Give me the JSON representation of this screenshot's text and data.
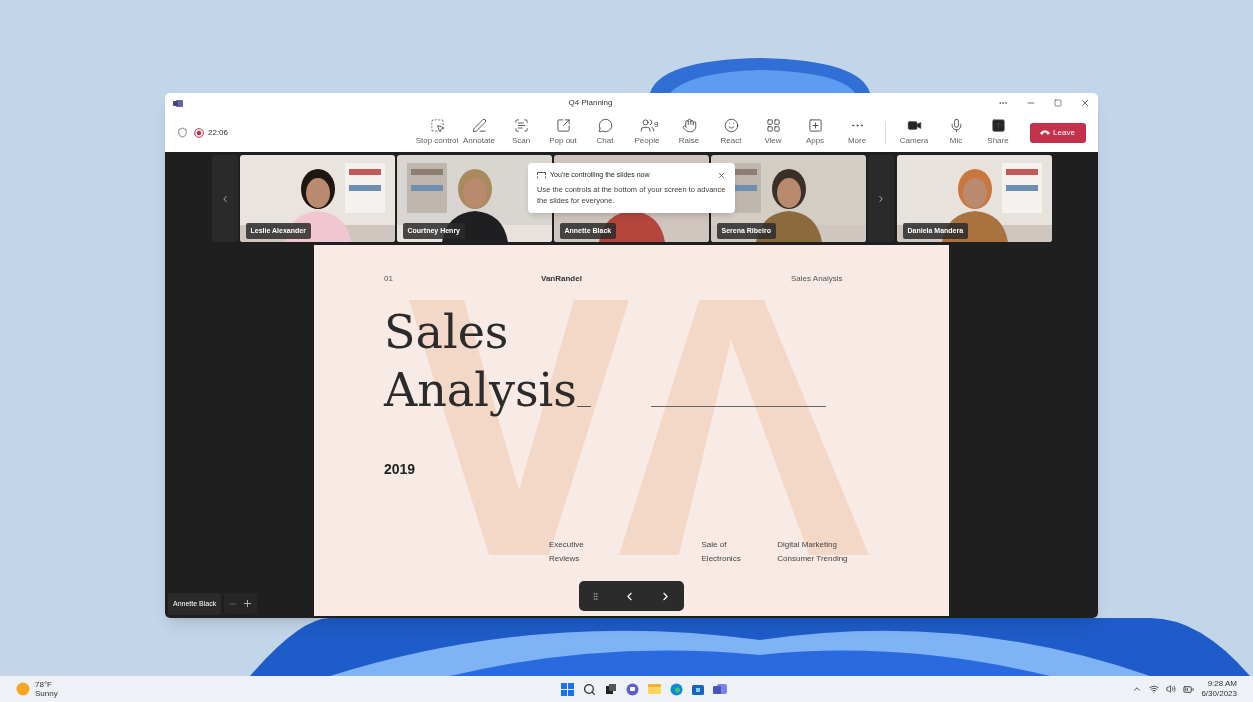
{
  "window": {
    "title": "Q4 Planning"
  },
  "meeting": {
    "timer": "22:06",
    "recording": true
  },
  "toolbar": [
    {
      "kind": "stopcontrol",
      "label": "Stop control"
    },
    {
      "kind": "annotate",
      "label": "Annotate"
    },
    {
      "kind": "scan",
      "label": "Scan"
    },
    {
      "kind": "popout",
      "label": "Pop out"
    },
    {
      "kind": "chat",
      "label": "Chat"
    },
    {
      "kind": "people",
      "label": "People",
      "badge": "9"
    },
    {
      "kind": "raise",
      "label": "Raise"
    },
    {
      "kind": "react",
      "label": "React"
    },
    {
      "kind": "view",
      "label": "View"
    },
    {
      "kind": "apps",
      "label": "Apps"
    },
    {
      "kind": "more",
      "label": "More"
    },
    {
      "kind": "camera",
      "label": "Camera"
    },
    {
      "kind": "mic",
      "label": "Mic"
    },
    {
      "kind": "share",
      "label": "Share"
    }
  ],
  "leave_button": "Leave",
  "participants": [
    {
      "name": "Leslie Alexander"
    },
    {
      "name": "Courtney Henry"
    },
    {
      "name": "Annette Black"
    },
    {
      "name": "Serena Ribeiro"
    },
    {
      "name": "Daniela Mandera"
    }
  ],
  "tooltip": {
    "title": "You're controlling the slides now",
    "body": "Use the controls at the bottom of your screen to advance the slides for everyone."
  },
  "slide": {
    "number": "01",
    "brand": "VanRandel",
    "header_right": "Sales Analysis",
    "title_line_1": "Sales",
    "title_line_2": "Analysis",
    "year": "2019",
    "footer": [
      {
        "line_1": "Executive",
        "line_2": "Reviews"
      },
      {
        "line_1": "Sale of",
        "line_2": "Electronics"
      },
      {
        "line_1": "Digital Marketing",
        "line_2": "Consumer Trending"
      }
    ]
  },
  "presenter_label": "Annette Black",
  "taskbar": {
    "temperature": "78°F",
    "weather": "Sunny",
    "time": "9:28 AM",
    "date": "6/30/2023"
  }
}
